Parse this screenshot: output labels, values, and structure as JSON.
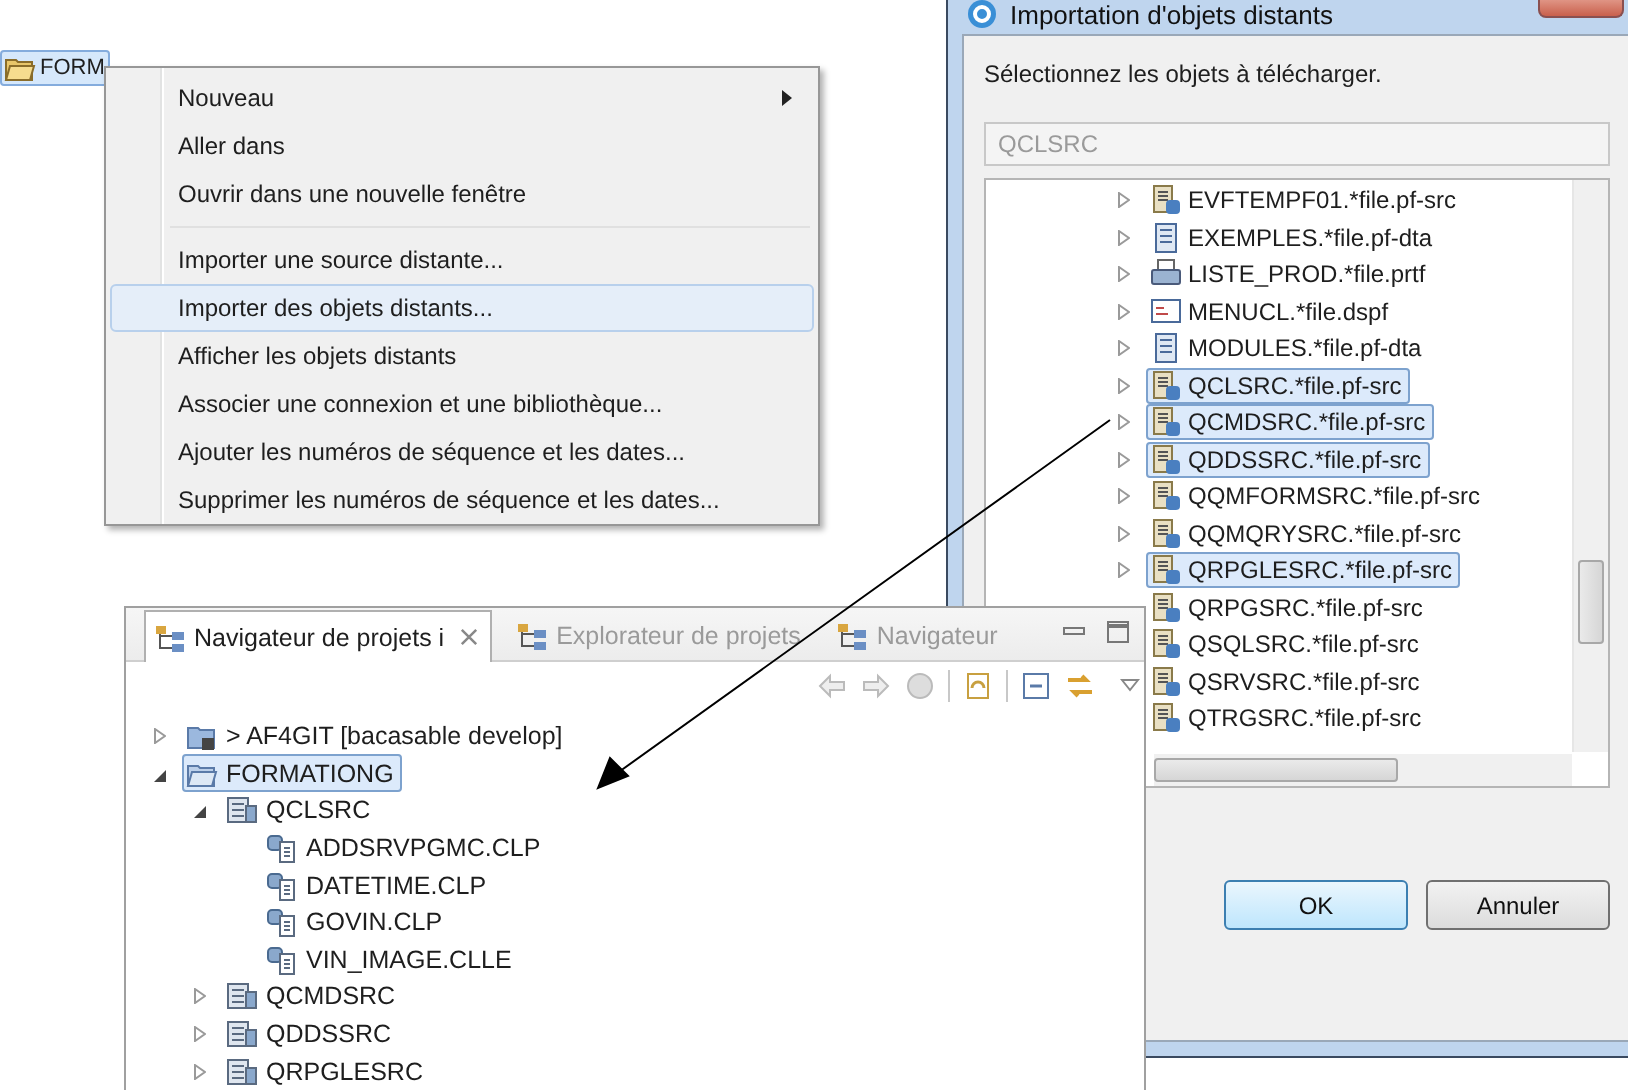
{
  "explorer_item": {
    "label": "FORM",
    "selected": true
  },
  "context_menu": {
    "items": [
      {
        "kind": "item",
        "label": "Nouveau",
        "submenu": true,
        "selected": false
      },
      {
        "kind": "item",
        "label": "Aller dans",
        "submenu": false,
        "selected": false
      },
      {
        "kind": "item",
        "label": "Ouvrir dans une nouvelle fenêtre",
        "submenu": false,
        "selected": false
      },
      {
        "kind": "separator"
      },
      {
        "kind": "item",
        "label": "Importer une source distante...",
        "submenu": false,
        "selected": false
      },
      {
        "kind": "item",
        "label": "Importer des objets distants...",
        "submenu": false,
        "selected": true
      },
      {
        "kind": "item",
        "label": "Afficher les objets distants",
        "submenu": false,
        "selected": false
      },
      {
        "kind": "item",
        "label": "Associer une connexion et une bibliothèque...",
        "submenu": false,
        "selected": false
      },
      {
        "kind": "item",
        "label": "Ajouter les numéros de séquence et les dates...",
        "submenu": false,
        "selected": false
      },
      {
        "kind": "item",
        "label": "Supprimer les numéros de séquence et les dates...",
        "submenu": false,
        "selected": false
      }
    ]
  },
  "dialog": {
    "title": "Importation d'objets distants",
    "instruction": "Sélectionnez les objets à télécharger.",
    "filter": {
      "value": "QCLSRC",
      "disabled": true
    },
    "objects": [
      {
        "label": "EVFTEMPF01.*file.pf-src",
        "kind": "source",
        "selected": false,
        "expandable": true
      },
      {
        "label": "EXEMPLES.*file.pf-dta",
        "kind": "data",
        "selected": false,
        "expandable": true
      },
      {
        "label": "LISTE_PROD.*file.prtf",
        "kind": "printer",
        "selected": false,
        "expandable": true
      },
      {
        "label": "MENUCL.*file.dspf",
        "kind": "display",
        "selected": false,
        "expandable": true
      },
      {
        "label": "MODULES.*file.pf-dta",
        "kind": "data",
        "selected": false,
        "expandable": true
      },
      {
        "label": "QCLSRC.*file.pf-src",
        "kind": "source",
        "selected": true,
        "expandable": true
      },
      {
        "label": "QCMDSRC.*file.pf-src",
        "kind": "source",
        "selected": true,
        "expandable": true
      },
      {
        "label": "QDDSSRC.*file.pf-src",
        "kind": "source",
        "selected": true,
        "expandable": true
      },
      {
        "label": "QQMFORMSRC.*file.pf-src",
        "kind": "source",
        "selected": false,
        "expandable": true
      },
      {
        "label": "QQMQRYSRC.*file.pf-src",
        "kind": "source",
        "selected": false,
        "expandable": true
      },
      {
        "label": "QRPGLESRC.*file.pf-src",
        "kind": "source",
        "selected": true,
        "expandable": true
      },
      {
        "label": "QRPGSRC.*file.pf-src",
        "kind": "source",
        "selected": false,
        "expandable": false
      },
      {
        "label": "QSQLSRC.*file.pf-src",
        "kind": "source",
        "selected": false,
        "expandable": false
      },
      {
        "label": "QSRVSRC.*file.pf-src",
        "kind": "source",
        "selected": false,
        "expandable": false
      },
      {
        "label": "QTRGSRC.*file.pf-src",
        "kind": "source",
        "selected": false,
        "expandable": false
      }
    ],
    "buttons": [
      {
        "label": "OK",
        "default": true
      },
      {
        "label": "Annuler",
        "default": false
      }
    ]
  },
  "navigator": {
    "tabs": [
      {
        "label": "Navigateur de projets i",
        "selected": true
      },
      {
        "label": "Explorateur de projets",
        "selected": false
      },
      {
        "label": "Navigateur",
        "selected": false
      }
    ],
    "tree": [
      {
        "label": "> AF4GIT [bacasable develop]",
        "kind": "project",
        "expanded": false,
        "selected": false
      },
      {
        "label": "FORMATIONG",
        "kind": "folder",
        "expanded": true,
        "selected": true,
        "children": [
          {
            "label": "QCLSRC",
            "kind": "sourcefile",
            "expanded": true,
            "selected": false,
            "children": [
              {
                "label": "ADDSRVPGMC.CLP",
                "kind": "member",
                "selected": false
              },
              {
                "label": "DATETIME.CLP",
                "kind": "member",
                "selected": false
              },
              {
                "label": "GOVIN.CLP",
                "kind": "member",
                "selected": false
              },
              {
                "label": "VIN_IMAGE.CLLE",
                "kind": "member",
                "selected": false
              }
            ]
          },
          {
            "label": "QCMDSRC",
            "kind": "sourcefile",
            "expanded": false,
            "selected": false
          },
          {
            "label": "QDDSSRC",
            "kind": "sourcefile",
            "expanded": false,
            "selected": false
          },
          {
            "label": "QRPGLESRC",
            "kind": "sourcefile",
            "expanded": false,
            "selected": false
          }
        ]
      }
    ]
  }
}
